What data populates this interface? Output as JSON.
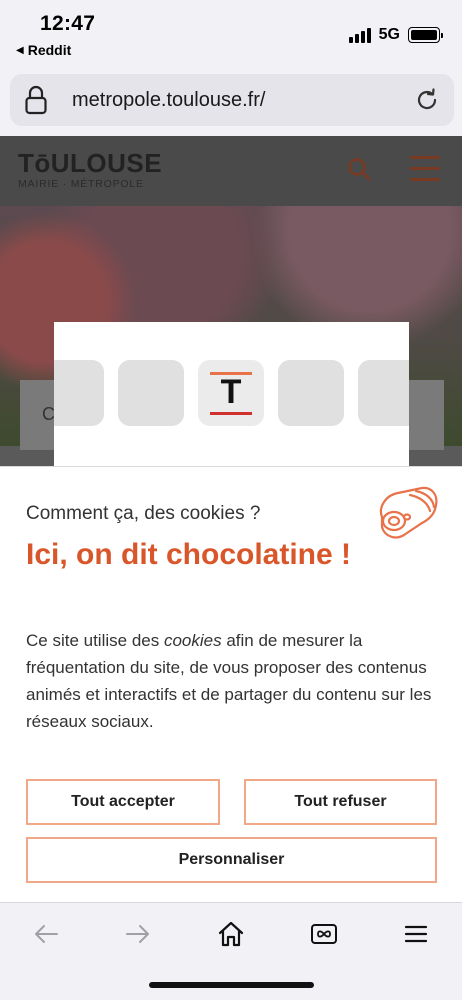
{
  "status_bar": {
    "time": "12:47",
    "back_app": "Reddit",
    "network": "5G"
  },
  "browser": {
    "url": "metropole.toulouse.fr/"
  },
  "site": {
    "logo_main": "TōULOUSE",
    "logo_sub": "MAIRIE · MÉTROPOLE",
    "search_partial": "C"
  },
  "apps_panel": {
    "active_tile_letter": "T"
  },
  "cookie_banner": {
    "question": "Comment ça, des cookies ?",
    "title": "Ici, on dit chocolatine !",
    "text_before": "Ce site utilise des ",
    "text_em": "cookies",
    "text_after": " afin de mesurer la fréquentation du site, de vous proposer des contenus animés et interactifs et de partager du contenu sur les réseaux sociaux.",
    "accept_label": "Tout accepter",
    "refuse_label": "Tout refuser",
    "customize_label": "Personnaliser"
  },
  "colors": {
    "accent": "#d9562a",
    "button_border": "#f0a888"
  }
}
